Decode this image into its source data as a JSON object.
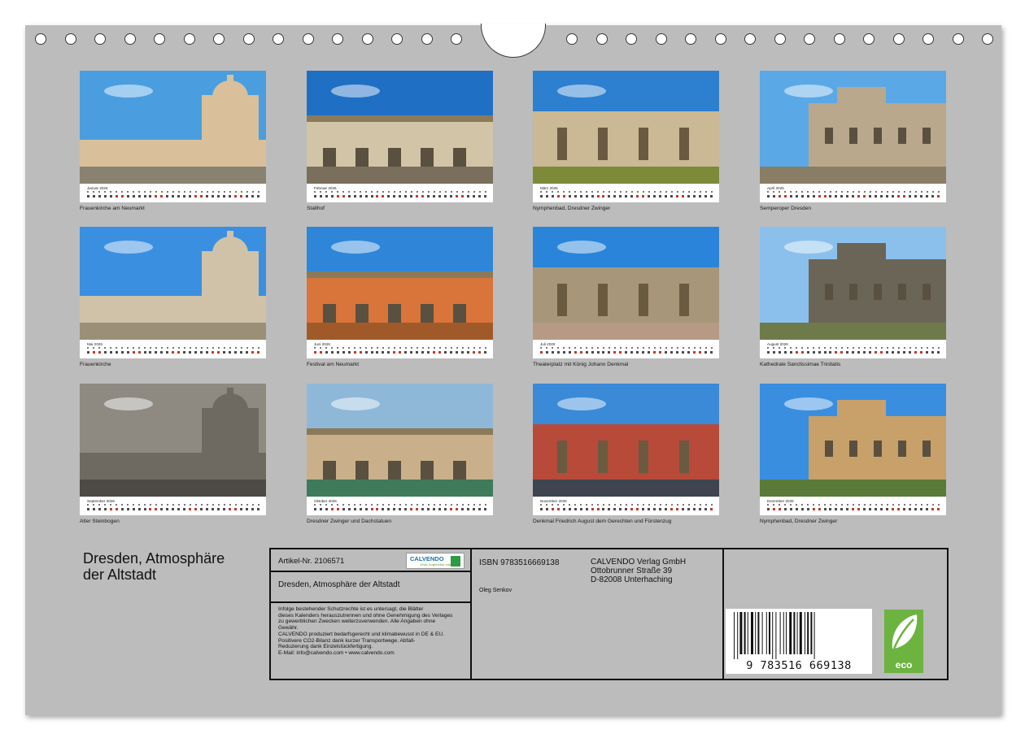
{
  "calendar_title": "Dresden, Atmosphäre der Altstadt",
  "calendar_title_lines": [
    "Dresden, Atmosphäre",
    "der Altstadt"
  ],
  "months": [
    {
      "month": "Januar 2026",
      "caption": "Frauenkirche am Neumarkt",
      "sky": "#4a9ee0",
      "main": "#d9c09a",
      "ground": "#8a8270"
    },
    {
      "month": "Februar 2026",
      "caption": "Stallhof",
      "sky": "#1f6fc4",
      "main": "#d2c4a6",
      "ground": "#7a6f5d"
    },
    {
      "month": "März 2026",
      "caption": "Nymphenbad, Dresdner Zwinger",
      "sky": "#2d7fd0",
      "main": "#cbb894",
      "ground": "#7c8a3a"
    },
    {
      "month": "April 2026",
      "caption": "Semperoper Dresden",
      "sky": "#5aa8e6",
      "main": "#b9a88c",
      "ground": "#8a7d66"
    },
    {
      "month": "Mai 2026",
      "caption": "Frauenkirche",
      "sky": "#3b8fe0",
      "main": "#cfc2a8",
      "ground": "#9b8f78"
    },
    {
      "month": "Juni 2026",
      "caption": "Festival am Neumarkt",
      "sky": "#2f86d8",
      "main": "#d9743a",
      "ground": "#a05a2a"
    },
    {
      "month": "Juli 2026",
      "caption": "Theaterplatz mit König Johann Denkmal",
      "sky": "#2a84da",
      "main": "#a8967a",
      "ground": "#b79a86"
    },
    {
      "month": "August 2026",
      "caption": "Kathedrale Sanctissimae Trinitatis",
      "sky": "#8cc0ec",
      "main": "#6b6558",
      "ground": "#6f7a4a"
    },
    {
      "month": "September 2026",
      "caption": "Alter Steinbogen",
      "sky": "#8e8a82",
      "main": "#6e6a62",
      "ground": "#4d4a45"
    },
    {
      "month": "Oktober 2026",
      "caption": "Dresdner Zwinger und Dachstatuen",
      "sky": "#8fb8d8",
      "main": "#c9b08a",
      "ground": "#3f7a5a"
    },
    {
      "month": "November 2026",
      "caption": "Denkmal Friedrich August dem Gerechten und Fürstenzug",
      "sky": "#3a8ad8",
      "main": "#b84a3a",
      "ground": "#3e4450"
    },
    {
      "month": "Dezember 2026",
      "caption": "Nymphenbad, Dresdner Zwinger",
      "sky": "#3a8ee0",
      "main": "#c8a06a",
      "ground": "#5a7a3a"
    }
  ],
  "info": {
    "article": "Artikel-Nr. 2106571",
    "logo_text": "CALVENDO",
    "logo_sub": "Jeder Augenblick zählt",
    "product_title": "Dresden, Atmosphäre der Altstadt",
    "legal_lines": [
      "Infolge bestehender Schutzrechte ist es untersagt, die Blätter",
      "dieses Kalenders herauszutrennen und ohne Genehmigung des Verlages",
      "zu gewerblichen Zwecken weiterzuverwenden. Alle Angaben ohne",
      "Gewähr.",
      "CALVENDO produziert bedarfsgerecht und klimabewusst in DE & EU.",
      "Positivere CO2-Bilanz dank kurzer Transportwege. Abfall-",
      "Reduzierung dank Einzelstückfertigung.",
      "E-Mail: info@calvendo.com • www.calvendo.com"
    ],
    "isbn": "ISBN 9783516669138",
    "author": "Oleg Senkov",
    "publisher_lines": [
      "CALVENDO Verlag GmbH",
      "Ottobrunner Straße 39",
      "D-82008 Unterhaching"
    ],
    "barcode_number": "9 783516 669138",
    "eco_label": "eco"
  }
}
